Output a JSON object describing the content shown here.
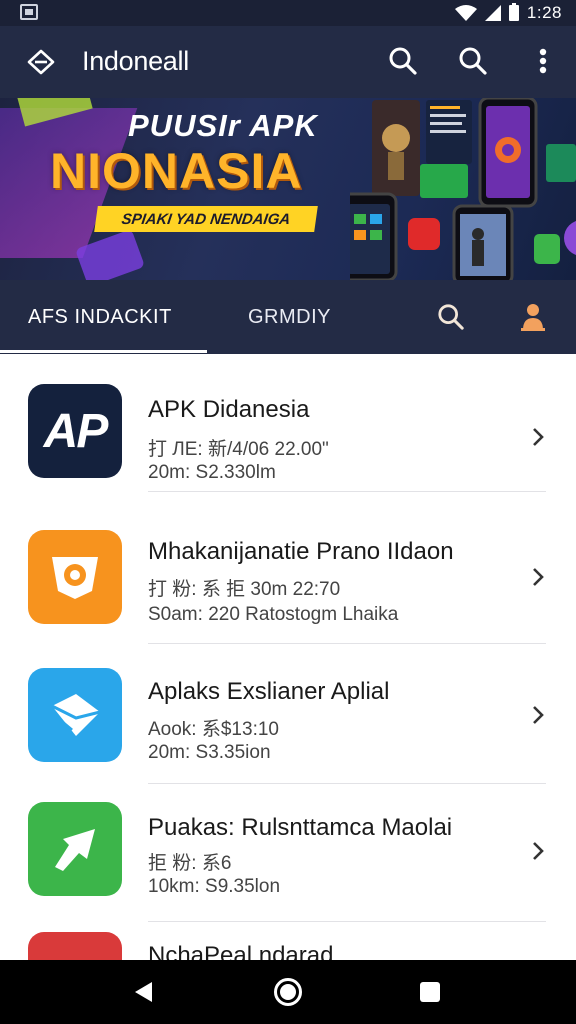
{
  "status_bar": {
    "time": "1:28",
    "icons": [
      "screenshot-icon",
      "wifi-icon",
      "signal-icon",
      "battery-icon"
    ]
  },
  "app_bar": {
    "title": "Indoneall",
    "icons": [
      "app-logo-icon",
      "search-icon",
      "search-icon",
      "more-vert-icon"
    ]
  },
  "banner": {
    "title_line1": "PUUSIr APK",
    "title_line2": "NIONASIA",
    "tagline": "SPIAKI YAD NENDAIGA",
    "colors": {
      "title2": "#ffb42a",
      "tag_bg": "#ffd324"
    }
  },
  "tabs": {
    "items": [
      {
        "label": "AFS INDACKIT",
        "selected": true
      },
      {
        "label": "GRMDIY",
        "selected": false
      }
    ],
    "icons": [
      "search-icon",
      "user-icon"
    ]
  },
  "list": {
    "items": [
      {
        "title": "APK Didanesia",
        "meta1": "打 ЛЕ: 新/4/06 22.00\"",
        "meta2": "20m: S2.330lm",
        "icon": "ap-logo-icon",
        "icon_text": "AP",
        "icon_color": "#14213d"
      },
      {
        "title": "Mhakanijanatie Prano IIdaon",
        "meta1": "打 粉: 系 拒 30m 22:70",
        "meta2": "S0am: 220 Ratostogm Lhaika",
        "icon": "camera-badge-icon",
        "icon_color": "#f7931e"
      },
      {
        "title": "Aplaks Exslianer Aplial",
        "meta1": "Aook: 系$13:10",
        "meta2": "20m: S3.35ion",
        "icon": "envelope-icon",
        "icon_color": "#2aa6ea"
      },
      {
        "title": "Puakas: Rulsnttamca Maolai",
        "meta1": "拒 粉: 系6",
        "meta2": "10km: S9.35lon",
        "icon": "arrow-share-icon",
        "icon_color": "#3cb54a"
      },
      {
        "title": "NchaPeal ndarad",
        "meta1": "",
        "meta2": "",
        "icon": "red-app-icon",
        "icon_color": "#d93a3a"
      }
    ]
  },
  "nav_bar": {
    "icons": [
      "back-icon",
      "home-icon",
      "recents-icon"
    ]
  }
}
